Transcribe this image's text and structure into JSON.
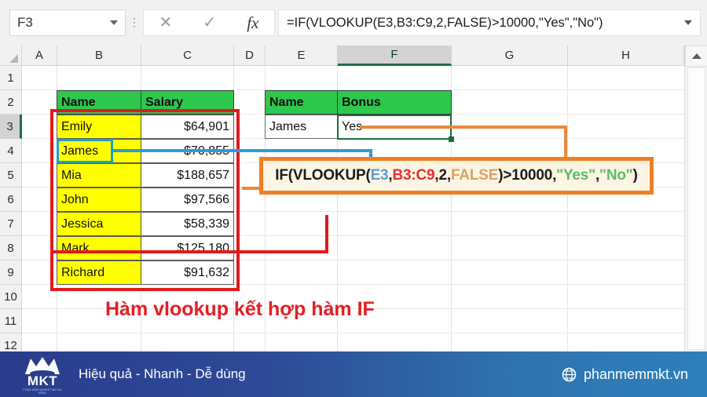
{
  "formula_bar": {
    "name_box_value": "F3",
    "cancel_icon": "close-icon",
    "enter_icon": "check-icon",
    "fx_icon": "fx-icon",
    "formula_value": "=IF(VLOOKUP(E3,B3:C9,2,FALSE)>10000,\"Yes\",\"No\")",
    "expand_icon": "chevron-down-icon",
    "namebox_dropdown_icon": "chevron-down-icon"
  },
  "grid": {
    "columns": [
      "A",
      "B",
      "C",
      "D",
      "E",
      "F",
      "G",
      "H"
    ],
    "selected_column": "F",
    "rows": [
      "1",
      "2",
      "3",
      "4",
      "5",
      "6",
      "7",
      "8",
      "9",
      "10",
      "11",
      "12"
    ],
    "selected_row": "3",
    "active_cell": "F3"
  },
  "salary_table": {
    "headers": [
      "Name",
      "Salary"
    ],
    "rows": [
      {
        "name": "Emily",
        "salary": "$64,901"
      },
      {
        "name": "James",
        "salary": "$70,855"
      },
      {
        "name": "Mia",
        "salary": "$188,657"
      },
      {
        "name": "John",
        "salary": "$97,566"
      },
      {
        "name": "Jessica",
        "salary": "$58,339"
      },
      {
        "name": "Mark",
        "salary": "$125,180"
      },
      {
        "name": "Richard",
        "salary": "$91,632"
      }
    ]
  },
  "lookup_table": {
    "headers": [
      "Name",
      "Bonus"
    ],
    "row": {
      "name": "James",
      "bonus": "Yes"
    }
  },
  "formula_callout": {
    "p1": "IF(VLOOKUP(",
    "lookup_value": "E3",
    "sep1": ",",
    "table_array": "B3:C9",
    "sep2": ",",
    "col_index": "2",
    "sep3": ",",
    "range_lookup": "FALSE",
    "p2": ")>10000,",
    "true_value": "\"Yes\"",
    "sep4": ",",
    "false_value": "\"No\"",
    "p3": ")"
  },
  "caption": {
    "text": "Hàm vlookup kết hợp hàm IF"
  },
  "footer": {
    "logo_text": "MKT",
    "logo_sub": "PHẦN MỀM MARKETING ĐA KÊNH",
    "slogan": "Hiệu quả - Nhanh - Dễ dùng",
    "website": "phanmemmkt.vn",
    "globe_icon": "globe-icon"
  },
  "scrollbar": {
    "up_icon": "arrow-up-icon"
  },
  "colors": {
    "header_green": "#2dc84d",
    "name_yellow": "#ffff00",
    "callout_orange": "#f07f24",
    "callout_bg": "#fdf5e4",
    "highlight_red": "#e01b1b",
    "connector_blue": "#2e9bd6",
    "connector_orange": "#e98a3d",
    "select_teal": "#1aa3c4",
    "caption_red": "#e31e24",
    "footer_blue": "#2a3c8c"
  }
}
